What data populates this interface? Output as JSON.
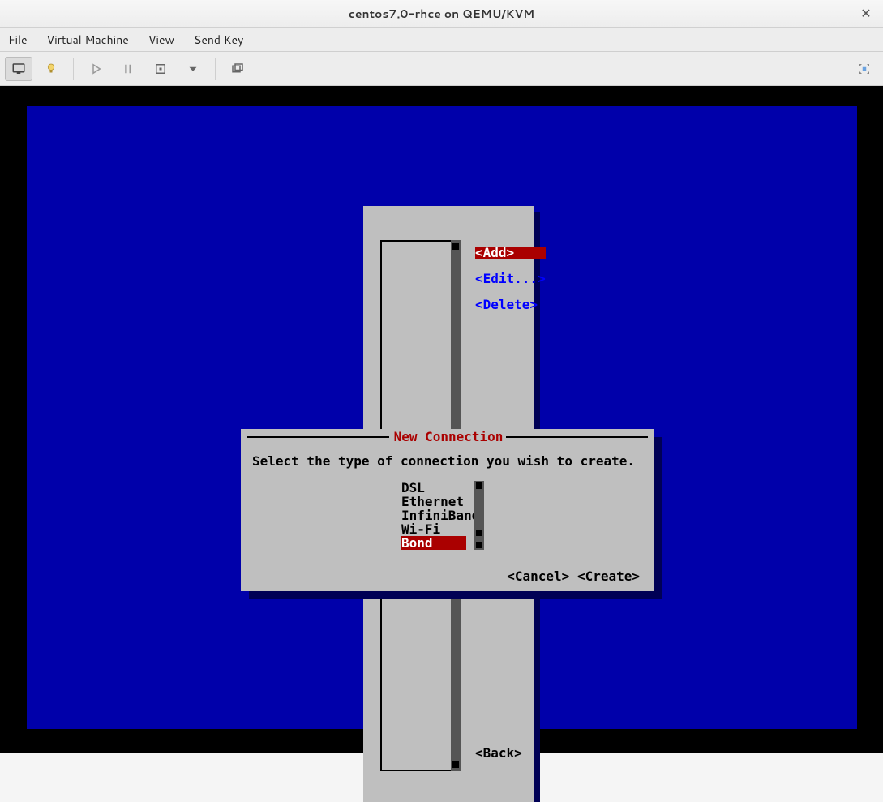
{
  "window": {
    "title": "centos7.0-rhce on QEMU/KVM"
  },
  "menubar": {
    "file": "File",
    "virtual_machine": "Virtual Machine",
    "view": "View",
    "send_key": "Send Key"
  },
  "main_panel": {
    "actions": {
      "add": "<Add>",
      "edit": "<Edit...>",
      "delete": "<Delete>"
    },
    "back": "<Back>"
  },
  "dialog": {
    "title": " New Connection ",
    "prompt": "Select the type of connection you wish to create.",
    "types": [
      "DSL",
      "Ethernet",
      "InfiniBand",
      "Wi-Fi",
      "Bond"
    ],
    "selected_index": 4,
    "cancel": "<Cancel>",
    "create": "<Create>"
  }
}
